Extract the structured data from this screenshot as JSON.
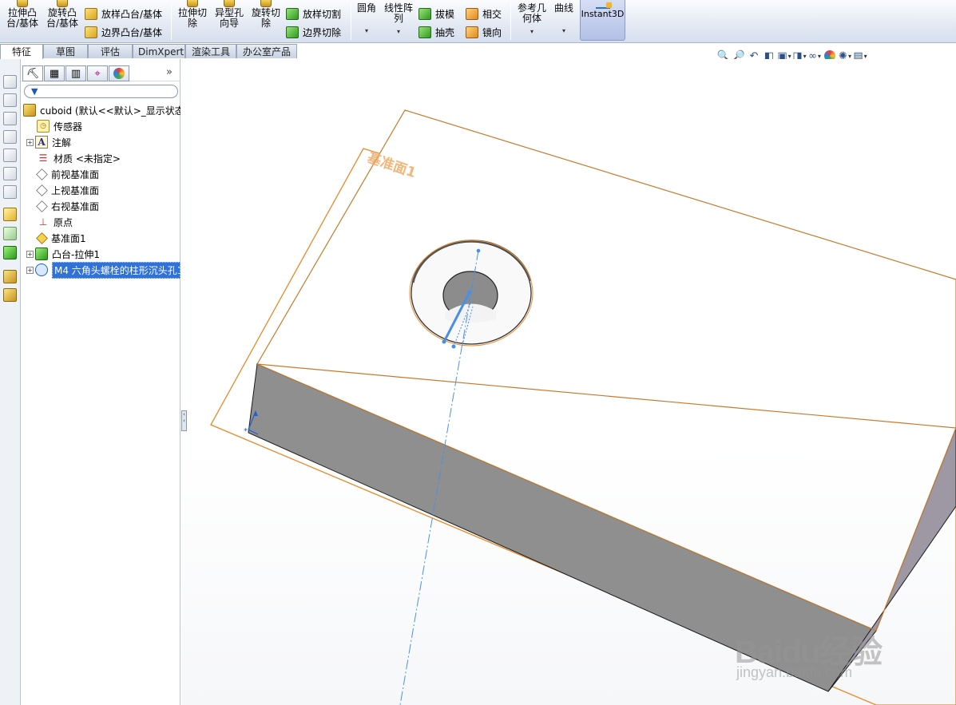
{
  "ribbon": {
    "extrude_boss": "拉伸凸\n台/基体",
    "revolve_boss": "旋转凸\n台/基体",
    "loft_boss": "放样凸台/基体",
    "boundary_boss": "边界凸台/基体",
    "extrude_cut": "拉伸切\n除",
    "hole_wizard": "异型孔\n向导",
    "revolve_cut": "旋转切\n除",
    "loft_cut": "放样切割",
    "boundary_cut": "边界切除",
    "fillet": "圆角",
    "linear_pattern": "线性阵\n列",
    "draft": "拔模",
    "shell": "抽壳",
    "intersect": "相交",
    "mirror": "镜向",
    "reference_geometry": "参考几\n何体",
    "curves": "曲线",
    "instant3d": "Instant3D"
  },
  "tabs": [
    "特征",
    "草图",
    "评估",
    "DimXpert",
    "渲染工具",
    "办公室产品"
  ],
  "tree": {
    "root": "cuboid  (默认<<默认>_显示状态",
    "items": [
      "传感器",
      "注解",
      "材质 <未指定>",
      "前视基准面",
      "上视基准面",
      "右视基准面",
      "原点",
      "基准面1",
      "凸台-拉伸1",
      "M4 六角头螺栓的柱形沉头孔1"
    ]
  },
  "viewport": {
    "plane_label": "基准面1"
  },
  "watermark": {
    "brand": "Baidu经验",
    "sub": "jingyan.baidu.com"
  },
  "colors": {
    "plane_orange": "#e8892b",
    "selection_blue": "#3072d8",
    "axis_blue": "#4a90e2",
    "side_face": "#8f8f8f",
    "right_face": "#9d98a4"
  }
}
